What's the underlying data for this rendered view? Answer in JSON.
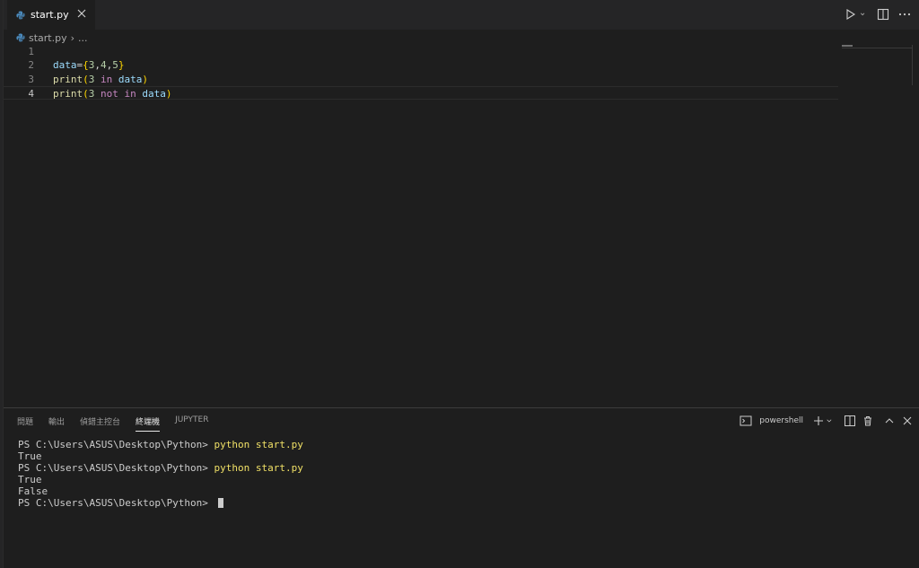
{
  "tab": {
    "label": "start.py",
    "icon": "python-file-icon"
  },
  "breadcrumb": {
    "file": "start.py",
    "separator": "›",
    "ellipsis": "..."
  },
  "editor": {
    "line_numbers": [
      "1",
      "2",
      "3",
      "4"
    ],
    "lines": [
      {
        "tokens": []
      },
      {
        "tokens": [
          {
            "text": "data",
            "cls": "tok-var"
          },
          {
            "text": "=",
            "cls": "tok-op"
          },
          {
            "text": "{",
            "cls": "tok-brace"
          },
          {
            "text": "3",
            "cls": "tok-num"
          },
          {
            "text": ",",
            "cls": "tok-op"
          },
          {
            "text": "4",
            "cls": "tok-num"
          },
          {
            "text": ",",
            "cls": "tok-op"
          },
          {
            "text": "5",
            "cls": "tok-num"
          },
          {
            "text": "}",
            "cls": "tok-brace"
          }
        ]
      },
      {
        "tokens": [
          {
            "text": "print",
            "cls": "tok-fn"
          },
          {
            "text": "(",
            "cls": "tok-brace"
          },
          {
            "text": "3",
            "cls": "tok-num"
          },
          {
            "text": " ",
            "cls": "tok-op"
          },
          {
            "text": "in",
            "cls": "tok-kw"
          },
          {
            "text": " ",
            "cls": "tok-op"
          },
          {
            "text": "data",
            "cls": "tok-var"
          },
          {
            "text": ")",
            "cls": "tok-brace"
          }
        ]
      },
      {
        "tokens": [
          {
            "text": "print",
            "cls": "tok-fn"
          },
          {
            "text": "(",
            "cls": "tok-brace"
          },
          {
            "text": "3",
            "cls": "tok-num"
          },
          {
            "text": " ",
            "cls": "tok-op"
          },
          {
            "text": "not",
            "cls": "tok-kw"
          },
          {
            "text": " ",
            "cls": "tok-op"
          },
          {
            "text": "in",
            "cls": "tok-kw"
          },
          {
            "text": " ",
            "cls": "tok-op"
          },
          {
            "text": "data",
            "cls": "tok-var"
          },
          {
            "text": ")",
            "cls": "tok-brace"
          }
        ]
      }
    ]
  },
  "panel": {
    "tabs": [
      "問題",
      "輸出",
      "偵錯主控台",
      "終端機",
      "JUPYTER"
    ],
    "active_tab": "終端機",
    "shell_label": "powershell"
  },
  "terminal": {
    "lines": [
      {
        "prompt": "PS C:\\Users\\ASUS\\Desktop\\Python> ",
        "command": "python start.py"
      },
      {
        "output": "True"
      },
      {
        "prompt": "PS C:\\Users\\ASUS\\Desktop\\Python> ",
        "command": "python start.py"
      },
      {
        "output": "True"
      },
      {
        "output": "False"
      },
      {
        "prompt": "PS C:\\Users\\ASUS\\Desktop\\Python> ",
        "command": "",
        "cursor": true
      }
    ]
  }
}
